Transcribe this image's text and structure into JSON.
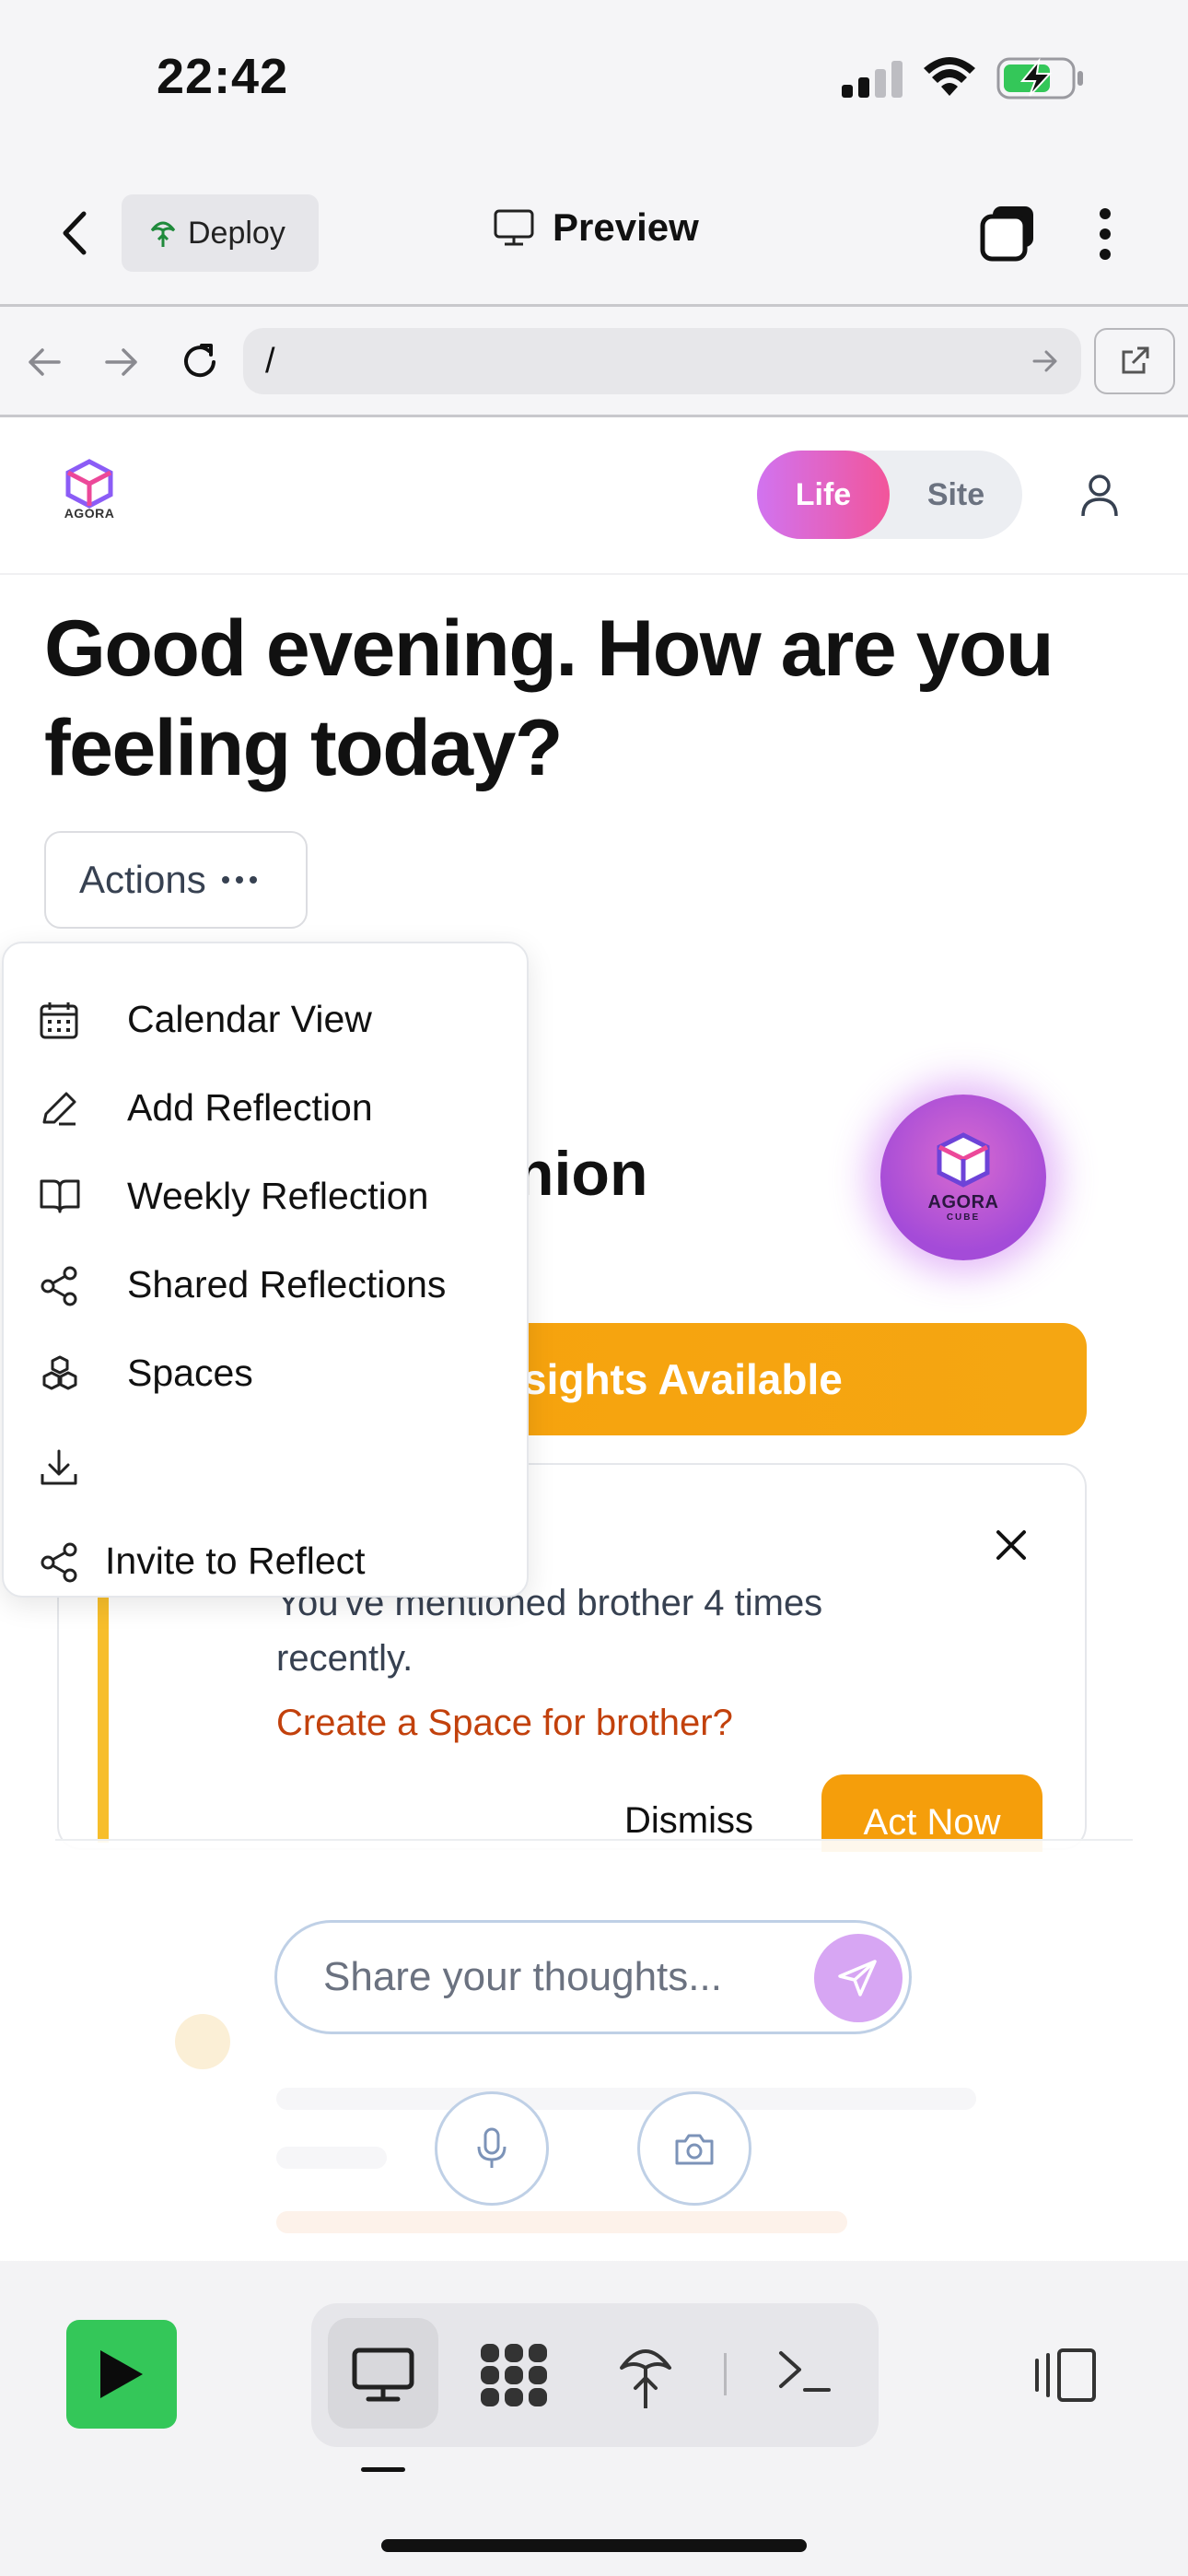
{
  "status_bar": {
    "time": "22:42"
  },
  "browser": {
    "deploy_label": "Deploy",
    "preview_label": "Preview",
    "url": "/"
  },
  "app": {
    "toggle": {
      "life": "Life",
      "site": "Site"
    },
    "greeting": "Good evening. How are you feeling today?",
    "actions_label": "Actions",
    "background_heading_fragment": "nion",
    "insights_fragment": "sights Available",
    "orb_logo_text": "AGORA",
    "orb_logo_sub": "CUBE",
    "header_logo_text": "AGORA",
    "insight_card": {
      "text": "You've mentioned brother 4 times recently.",
      "link": "Create a Space for brother?",
      "dismiss": "Dismiss",
      "act_now": "Act Now"
    },
    "input_placeholder": "Share your thoughts..."
  },
  "actions_menu": {
    "items": [
      {
        "label": "Calendar View",
        "icon": "calendar-icon"
      },
      {
        "label": "Add Reflection",
        "icon": "pen-icon"
      },
      {
        "label": "Weekly Reflection",
        "icon": "book-icon"
      },
      {
        "label": "Shared Reflections",
        "icon": "share-icon"
      },
      {
        "label": "Spaces",
        "icon": "cubes-icon"
      },
      {
        "label": "",
        "icon": "download-icon"
      },
      {
        "label": "Invite to Reflect",
        "icon": "share-icon"
      }
    ]
  },
  "colors": {
    "accent_orange": "#f59e0b",
    "life_gradient": [
      "#d173f0",
      "#f2559a"
    ],
    "play_green": "#34c759"
  }
}
